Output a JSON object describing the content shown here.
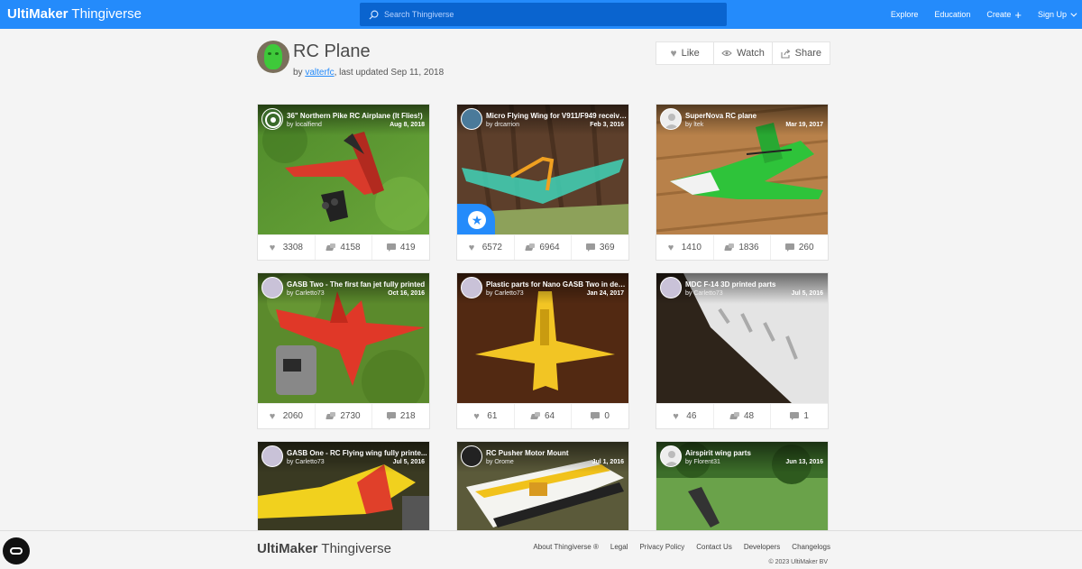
{
  "header": {
    "logo_bold": "UltiMaker",
    "logo_rest": " Thingiverse",
    "search_placeholder": "Search Thingiverse",
    "nav": {
      "explore": "Explore",
      "education": "Education",
      "create": "Create",
      "signup": "Sign Up"
    }
  },
  "collection": {
    "title": "RC Plane",
    "by": "by ",
    "author": "valterfc",
    "updated": ", last updated Sep 11, 2018",
    "actions": {
      "like": "Like",
      "watch": "Watch",
      "share": "Share"
    }
  },
  "colors": {
    "brand": "#248bfb",
    "search_bg": "#0a64cf"
  },
  "cards": [
    {
      "title": "36\" Northern Pike RC Airplane (It Flies!)",
      "user": "by localfiend",
      "date": "Aug 8, 2018",
      "likes": "3308",
      "makes": "4158",
      "comments": "419"
    },
    {
      "title": "Micro Flying Wing for V911/F949 receive...",
      "user": "by drcarrion",
      "date": "Feb 3, 2016",
      "likes": "6572",
      "makes": "6964",
      "comments": "369",
      "featured": true
    },
    {
      "title": "SuperNova RC plane",
      "user": "by ltek",
      "date": "Mar 19, 2017",
      "likes": "1410",
      "makes": "1836",
      "comments": "260"
    },
    {
      "title": "GASB Two - The first fan jet fully printed",
      "user": "by Carletto73",
      "date": "Oct 16, 2016",
      "likes": "2060",
      "makes": "2730",
      "comments": "218"
    },
    {
      "title": "Plastic parts for Nano GASB Two in dep...",
      "user": "by Carletto73",
      "date": "Jan 24, 2017",
      "likes": "61",
      "makes": "64",
      "comments": "0"
    },
    {
      "title": "MDC F-14 3D printed parts",
      "user": "by Carletto73",
      "date": "Jul 5, 2016",
      "likes": "46",
      "makes": "48",
      "comments": "1"
    },
    {
      "title": "GASB One - RC Flying wing fully printe...",
      "user": "by Carletto73",
      "date": "Jul 5, 2016"
    },
    {
      "title": "RC Pusher Motor Mount",
      "user": "by Orome",
      "date": "Jul 1, 2016"
    },
    {
      "title": "Airspirit wing parts",
      "user": "by Florent31",
      "date": "Jun 13, 2016"
    }
  ],
  "footer": {
    "logo_bold": "UltiMaker",
    "logo_rest": " Thingiverse",
    "links": {
      "about": "About Thingiverse ®",
      "legal": "Legal",
      "privacy": "Privacy Policy",
      "contact": "Contact Us",
      "developers": "Developers",
      "changelogs": "Changelogs"
    },
    "copyright": "© 2023 UltiMaker BV"
  }
}
